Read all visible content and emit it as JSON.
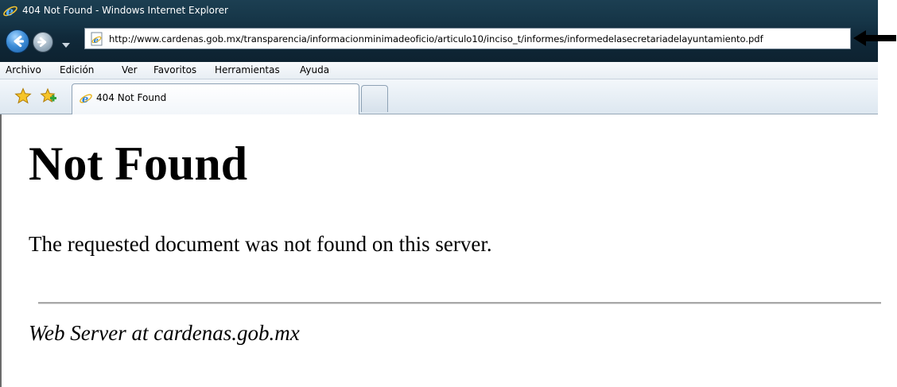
{
  "window": {
    "title": "404 Not Found - Windows Internet Explorer"
  },
  "address_bar": {
    "url": "http://www.cardenas.gob.mx/transparencia/informacionminimadeoficio/articulo10/inciso_t/informes/informedelasecretariadelayuntamiento.pdf"
  },
  "menu": {
    "items": [
      "Archivo",
      "Edición",
      "Ver",
      "Favoritos",
      "Herramientas",
      "Ayuda"
    ]
  },
  "tabs": [
    {
      "label": "404 Not Found",
      "active": true
    }
  ],
  "page": {
    "heading": "Not Found",
    "message": "The requested document was not found on this server.",
    "signature": "Web Server at cardenas.gob.mx"
  },
  "icons": {
    "title": "ie-logo-icon",
    "back": "back-arrow-icon",
    "forward": "forward-arrow-icon",
    "page": "ie-page-icon",
    "favorites": "favorites-star-icon",
    "add_favorite": "add-favorite-icon",
    "annotation": "pointer-arrow-icon"
  },
  "colors": {
    "chrome_dark": "#153446",
    "menu_bg": "#eef2f6",
    "content_bg": "#ffffff",
    "rule": "#a8a8a8"
  }
}
